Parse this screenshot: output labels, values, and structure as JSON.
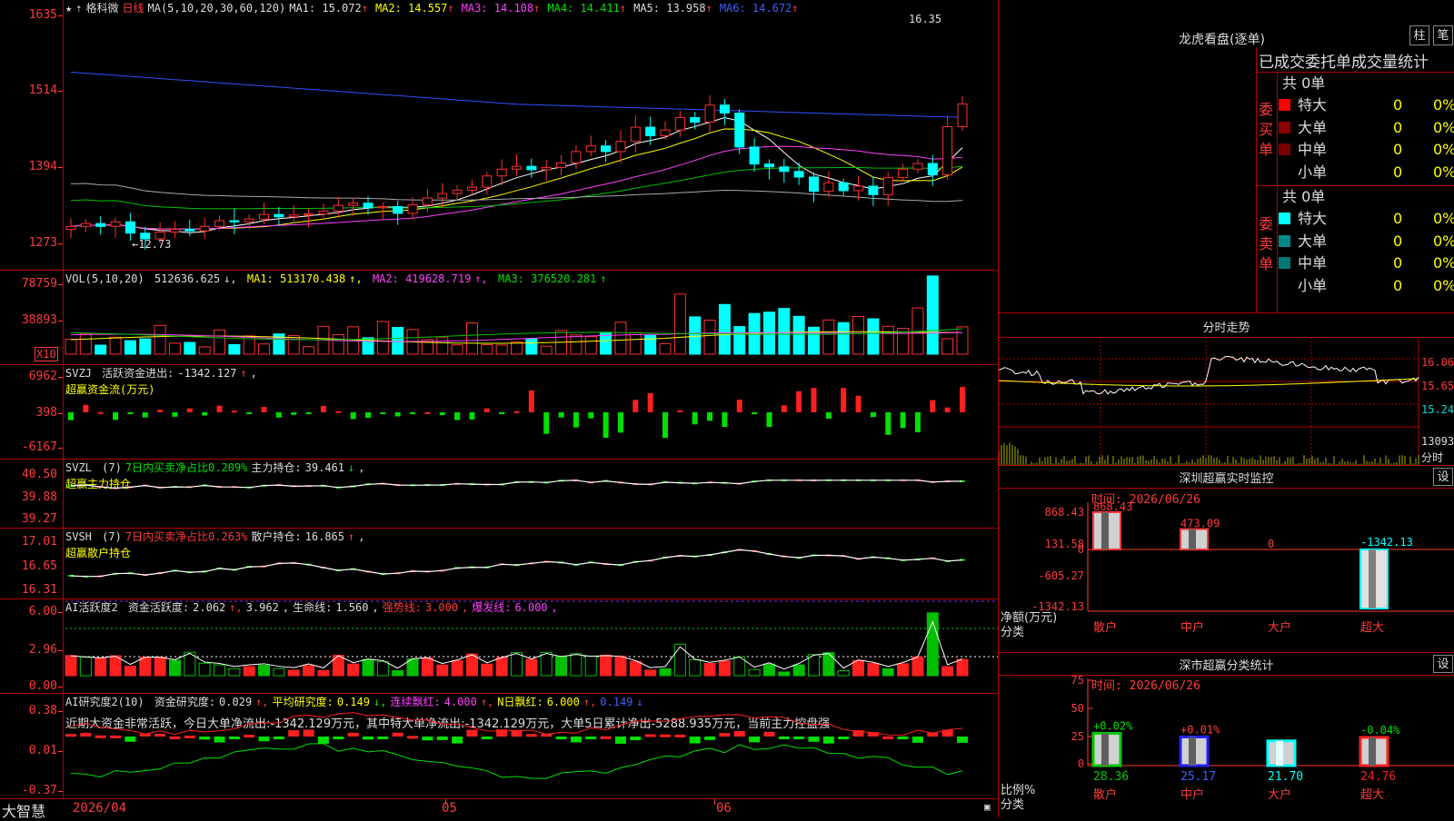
{
  "main": {
    "stock_name": "格科微",
    "period": "日线",
    "ma_params": "MA(5,10,20,30,60,120)",
    "ma_values": [
      {
        "label": "MA1:",
        "value": "15.072",
        "arrow": "↑",
        "color": "#dddddd"
      },
      {
        "label": "MA2:",
        "value": "14.557",
        "arrow": "↑",
        "color": "#ffff00"
      },
      {
        "label": "MA3:",
        "value": "14.108",
        "arrow": "↑",
        "color": "#ff40ff"
      },
      {
        "label": "MA4:",
        "value": "14.411",
        "arrow": "↑",
        "color": "#00e000"
      },
      {
        "label": "MA5:",
        "value": "13.958",
        "arrow": "↑",
        "color": "#dddddd"
      },
      {
        "label": "MA6:",
        "value": "14.672",
        "arrow": "↑",
        "color": "#4060ff"
      }
    ],
    "y_ticks": [
      "1635",
      "1514",
      "1394",
      "1273"
    ],
    "high_label": "16.35",
    "low_label": "12.73"
  },
  "volume": {
    "header": "VOL(5,10,20)",
    "value": "512636.625",
    "ma1": "513170.438",
    "ma2": "419628.719",
    "ma3": "376520.281",
    "y_ticks": [
      "78759",
      "38893"
    ],
    "unit": "X10"
  },
  "svzj": {
    "name": "SVZJ",
    "label": "活跃资金进出:",
    "value": "-1342.127",
    "sub": "超赢资金流(万元)",
    "y_ticks": [
      "6962",
      "398",
      "-6167"
    ]
  },
  "svzl": {
    "name": "SVZL",
    "param": "(7)",
    "label1": "7日内买卖净占比0.209%",
    "label2": "主力持仓:",
    "value": "39.461",
    "sub": "超赢主力持仓",
    "y_ticks": [
      "40.50",
      "39.88",
      "39.27"
    ]
  },
  "svsh": {
    "name": "SVSH",
    "param": "(7)",
    "label1": "7日内买卖净占比0.263%",
    "label2": "散户持仓:",
    "value": "16.865",
    "sub": "超赢散户持仓",
    "y_ticks": [
      "17.01",
      "16.65",
      "16.31"
    ]
  },
  "ai_active": {
    "name": "AI活跃度2",
    "label": "资金活跃度:",
    "v1": "2.062",
    "v2": "3.962",
    "life_label": "生命线:",
    "life": "1.560",
    "strong_label": "强势线:",
    "strong": "3.000",
    "burst_label": "爆发线:",
    "burst": "6.000",
    "y_ticks": [
      "6.00",
      "2.96",
      "0.00"
    ]
  },
  "ai_research": {
    "name": "AI研究度2(10)",
    "label": "资金研究度:",
    "v1": "0.029",
    "avg_label": "平均研究度:",
    "avg": "0.149",
    "streak_label": "连续飘红:",
    "streak": "4.000",
    "nday_label": "N日飘红:",
    "nday": "6.000",
    "v5": "0.149",
    "summary": "近期大资金非常活跃，今日大单净流出:-1342.129万元，其中特大单净流出:-1342.129万元，大单5日累计净出-5288.935万元，当前主力控盘强",
    "y_ticks": [
      "0.38",
      "0.01",
      "-0.37"
    ]
  },
  "bottom": {
    "brand": "大智慧",
    "dates": [
      "2026/04",
      "05",
      "06"
    ]
  },
  "right": {
    "dragon_title": "龙虎看盘(逐单)",
    "btn_bar": "柱",
    "btn_pen": "笔",
    "tabs": "已成交委托单成交量统计",
    "buy_side": "委买单",
    "sell_side": "委卖单",
    "buy_total": "共 0单",
    "sell_total": "共 0单",
    "buy_rows": [
      {
        "label": "特大",
        "n": "0",
        "pct": "0%",
        "color": "#ff0000"
      },
      {
        "label": "大单",
        "n": "0",
        "pct": "0%",
        "color": "#8b0000"
      },
      {
        "label": "中单",
        "n": "0",
        "pct": "0%",
        "color": "#7a0000"
      },
      {
        "label": "小单",
        "n": "0",
        "pct": "0%",
        "color": "#000000"
      }
    ],
    "sell_rows": [
      {
        "label": "特大",
        "n": "0",
        "pct": "0%",
        "color": "#00ffff"
      },
      {
        "label": "大单",
        "n": "0",
        "pct": "0%",
        "color": "#008888"
      },
      {
        "label": "中单",
        "n": "0",
        "pct": "0%",
        "color": "#007777"
      },
      {
        "label": "小单",
        "n": "0",
        "pct": "0%",
        "color": "#000000"
      }
    ],
    "intraday_title": "分时走势",
    "intraday_ticks": [
      "16.06",
      "15.65",
      "15.24"
    ],
    "intraday_vol": "13093",
    "intraday_unit": "分时",
    "monitor_title": "深圳超赢实时监控",
    "monitor_btn": "设",
    "monitor_time": "时间: 2026/06/26",
    "monitor_ticks": [
      "868.43",
      "131.58",
      "0",
      "-605.27",
      "-1342.13"
    ],
    "monitor_ylabel": "净额(万元)",
    "monitor_xlabel": "分类",
    "monitor_bars": [
      {
        "label": "散户",
        "value": "868.43",
        "v": 868.43
      },
      {
        "label": "中户",
        "value": "473.09",
        "v": 473.09
      },
      {
        "label": "大户",
        "value": "0",
        "v": 0
      },
      {
        "label": "超大",
        "value": "-1342.13",
        "v": -1342.13
      }
    ],
    "stat_title": "深市超赢分类统计",
    "stat_btn": "设",
    "stat_time": "时间: 2026/06/26",
    "stat_ticks": [
      "75",
      "50",
      "25",
      "0"
    ],
    "stat_ylabel": "比例%",
    "stat_xlabel": "分类",
    "stat_bars": [
      {
        "label": "散户",
        "pct": "28.36",
        "delta": "+0.02%",
        "v": 28.36,
        "color": "#00cc00",
        "dcolor": "#00e000"
      },
      {
        "label": "中户",
        "pct": "25.17",
        "delta": "+0.01%",
        "v": 25.17,
        "color": "#2020ff",
        "dcolor": "#ff3b3b"
      },
      {
        "label": "大户",
        "pct": "21.70",
        "delta": "",
        "v": 21.7,
        "color": "#00ffff",
        "dcolor": "#00e000"
      },
      {
        "label": "超大",
        "pct": "24.76",
        "delta": "-0.04%",
        "v": 24.76,
        "color": "#ff2020",
        "dcolor": "#00e000"
      }
    ]
  }
}
